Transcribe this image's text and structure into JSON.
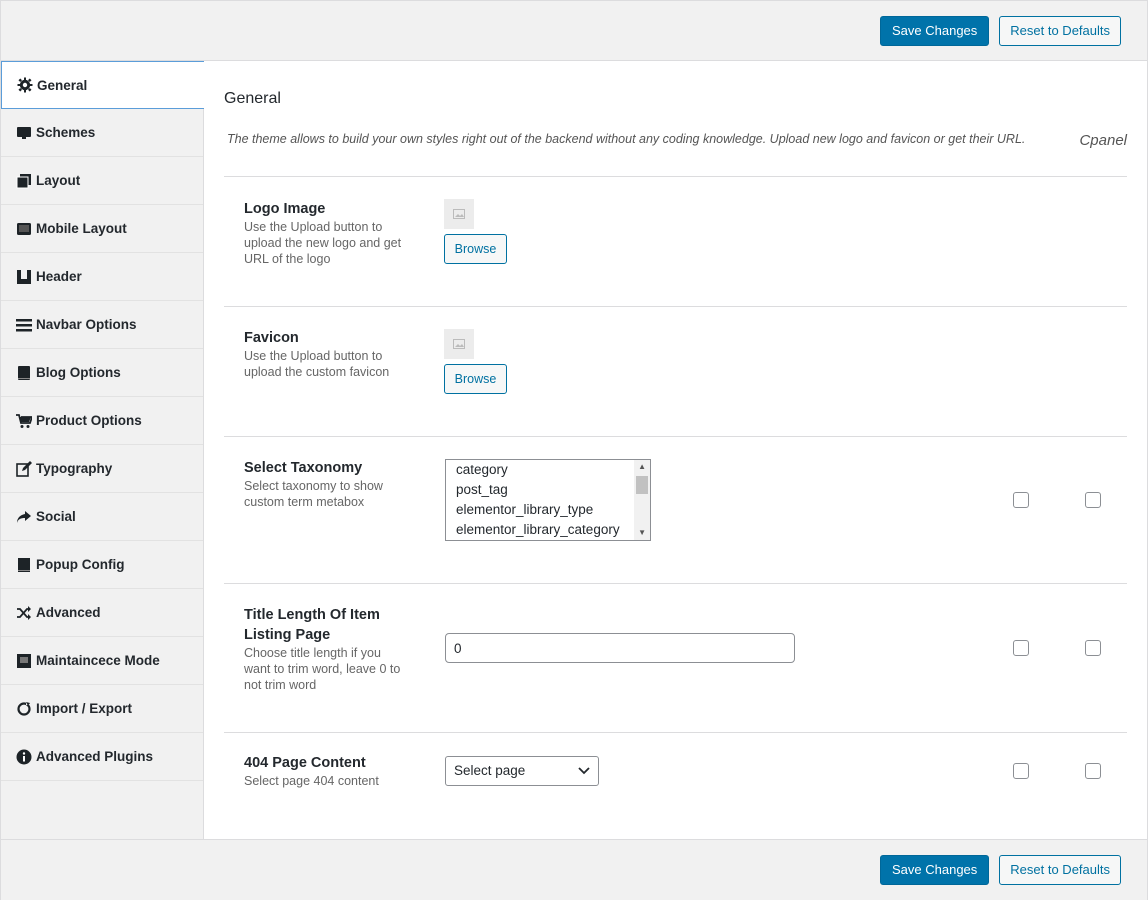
{
  "toolbar": {
    "save_label": "Save Changes",
    "reset_label": "Reset to Defaults"
  },
  "sidebar": {
    "items": [
      {
        "label": "General",
        "icon": "gear-icon"
      },
      {
        "label": "Schemes",
        "icon": "monitor-icon"
      },
      {
        "label": "Layout",
        "icon": "copy-icon"
      },
      {
        "label": "Mobile Layout",
        "icon": "tablet-icon"
      },
      {
        "label": "Header",
        "icon": "header-icon"
      },
      {
        "label": "Navbar Options",
        "icon": "menu-icon"
      },
      {
        "label": "Blog Options",
        "icon": "book-icon"
      },
      {
        "label": "Product Options",
        "icon": "cart-icon"
      },
      {
        "label": "Typography",
        "icon": "edit-icon"
      },
      {
        "label": "Social",
        "icon": "share-icon"
      },
      {
        "label": "Popup Config",
        "icon": "popup-icon"
      },
      {
        "label": "Advanced",
        "icon": "shuffle-icon"
      },
      {
        "label": "Maintaincece Mode",
        "icon": "maintenance-icon"
      },
      {
        "label": "Import / Export",
        "icon": "refresh-icon"
      },
      {
        "label": "Advanced Plugins",
        "icon": "info-icon"
      }
    ]
  },
  "main": {
    "title": "General",
    "description": "The theme allows to build your own styles right out of the backend without any coding knowledge. Upload new logo and favicon or get their URL.",
    "cpanel": "Cpanel",
    "logo": {
      "title": "Logo Image",
      "desc": "Use the Upload button to upload the new logo and get URL of the logo",
      "browse_label": "Browse"
    },
    "favicon": {
      "title": "Favicon",
      "desc": "Use the Upload button to upload the custom favicon",
      "browse_label": "Browse"
    },
    "taxonomy": {
      "title": "Select Taxonomy",
      "desc": "Select taxonomy to show custom term metabox",
      "options": [
        "category",
        "post_tag",
        "elementor_library_type",
        "elementor_library_category"
      ]
    },
    "title_length": {
      "title": "Title Length Of Item Listing Page",
      "desc": "Choose title length if you want to trim word, leave 0 to not trim word",
      "value": "0"
    },
    "page404": {
      "title": "404 Page Content",
      "desc": "Select page 404 content",
      "selected": "Select page"
    }
  }
}
